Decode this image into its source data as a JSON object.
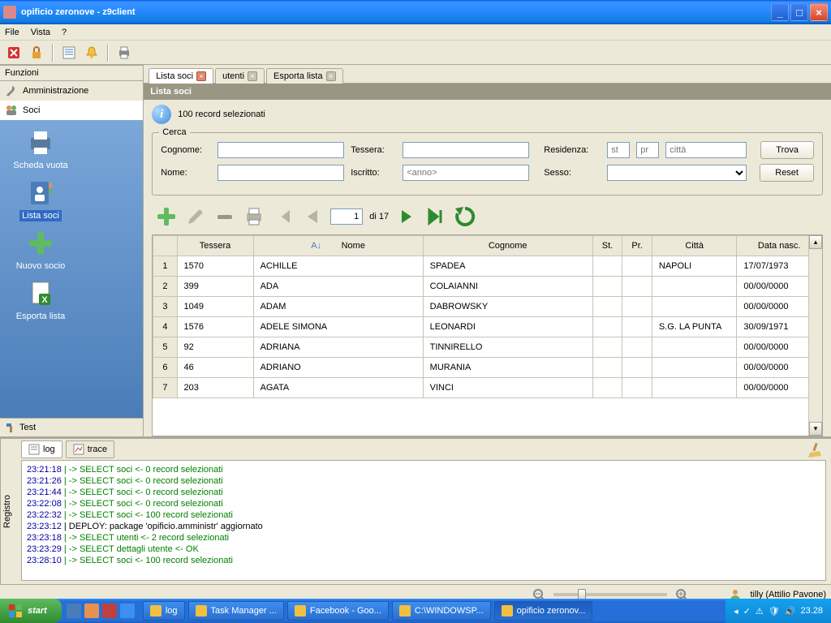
{
  "window": {
    "title": "opificio zeronove - z9client"
  },
  "menu": {
    "file": "File",
    "vista": "Vista",
    "help": "?"
  },
  "sidebar": {
    "heading": "Funzioni",
    "items": [
      {
        "label": "Amministrazione"
      },
      {
        "label": "Soci"
      }
    ],
    "icons": {
      "scheda_vuota": "Scheda vuota",
      "lista_soci": "Lista soci",
      "nuovo_socio": "Nuovo socio",
      "esporta_lista": "Esporta lista"
    },
    "footer": "Test"
  },
  "tabs": [
    {
      "label": "Lista soci",
      "active": true
    },
    {
      "label": "utenti",
      "active": false
    },
    {
      "label": "Esporta lista",
      "active": false
    }
  ],
  "panel": {
    "title": "Lista soci",
    "info": "100 record selezionati"
  },
  "cerca": {
    "legend": "Cerca",
    "cognome_lbl": "Cognome:",
    "nome_lbl": "Nome:",
    "tessera_lbl": "Tessera:",
    "iscritto_lbl": "Iscritto:",
    "iscritto_ph": "<anno>",
    "residenza_lbl": "Residenza:",
    "res_st_ph": "st",
    "res_pr_ph": "pr",
    "res_citta_ph": "città",
    "sesso_lbl": "Sesso:",
    "trova": "Trova",
    "reset": "Reset"
  },
  "paging": {
    "page": "1",
    "of_label": "di 17"
  },
  "grid": {
    "headers": {
      "tessera": "Tessera",
      "nome": "Nome",
      "cognome": "Cognome",
      "st": "St.",
      "pr": "Pr.",
      "citta": "Città",
      "data": "Data nasc."
    },
    "rows": [
      {
        "n": "1",
        "tessera": "1570",
        "nome": "ACHILLE",
        "cognome": "SPADEA",
        "st": "",
        "pr": "",
        "citta": "NAPOLI",
        "data": "17/07/1973"
      },
      {
        "n": "2",
        "tessera": "399",
        "nome": "ADA",
        "cognome": "COLAIANNI",
        "st": "",
        "pr": "",
        "citta": "",
        "data": "00/00/0000"
      },
      {
        "n": "3",
        "tessera": "1049",
        "nome": "ADAM",
        "cognome": "DABROWSKY",
        "st": "",
        "pr": "",
        "citta": "",
        "data": "00/00/0000"
      },
      {
        "n": "4",
        "tessera": "1576",
        "nome": "ADELE SIMONA",
        "cognome": "LEONARDI",
        "st": "",
        "pr": "",
        "citta": "S.G. LA PUNTA",
        "data": "30/09/1971"
      },
      {
        "n": "5",
        "tessera": "92",
        "nome": "ADRIANA",
        "cognome": "TINNIRELLO",
        "st": "",
        "pr": "",
        "citta": "",
        "data": "00/00/0000"
      },
      {
        "n": "6",
        "tessera": "46",
        "nome": "ADRIANO",
        "cognome": "MURANIA",
        "st": "",
        "pr": "",
        "citta": "",
        "data": "00/00/0000"
      },
      {
        "n": "7",
        "tessera": "203",
        "nome": "AGATA",
        "cognome": "VINCI",
        "st": "",
        "pr": "",
        "citta": "",
        "data": "00/00/0000"
      }
    ]
  },
  "log": {
    "tab_log": "log",
    "tab_trace": "trace",
    "side": "Registro",
    "lines": [
      {
        "ts": "23:21:18",
        "txt": " | -> SELECT soci <- 0 record selezionati",
        "cls": "g"
      },
      {
        "ts": "23:21:26",
        "txt": " | -> SELECT soci <- 0 record selezionati",
        "cls": "g"
      },
      {
        "ts": "23:21:44",
        "txt": " | -> SELECT soci <- 0 record selezionati",
        "cls": "g"
      },
      {
        "ts": "23:22:08",
        "txt": " | -> SELECT soci <- 0 record selezionati",
        "cls": "g"
      },
      {
        "ts": "23:22:32",
        "txt": " | -> SELECT soci <- 100 record selezionati",
        "cls": "g"
      },
      {
        "ts": "23:23:12",
        "txt": " | DEPLOY: package 'opificio.amministr' aggiornato",
        "cls": "k"
      },
      {
        "ts": "23:23:18",
        "txt": " | -> SELECT utenti <- 2 record selezionati",
        "cls": "g"
      },
      {
        "ts": "23:23:29",
        "txt": " | -> SELECT dettagli utente <- OK",
        "cls": "g"
      },
      {
        "ts": "23:28:10",
        "txt": " | -> SELECT soci <- 100 record selezionati",
        "cls": "g"
      }
    ]
  },
  "status": {
    "user": "tilly (Attilio Pavone)"
  },
  "taskbar": {
    "start": "start",
    "items": [
      {
        "label": "log"
      },
      {
        "label": "Task Manager ..."
      },
      {
        "label": "Facebook - Goo..."
      },
      {
        "label": "C:\\WINDOWSP..."
      },
      {
        "label": "opificio zeronov..."
      }
    ],
    "clock": "23.28"
  }
}
